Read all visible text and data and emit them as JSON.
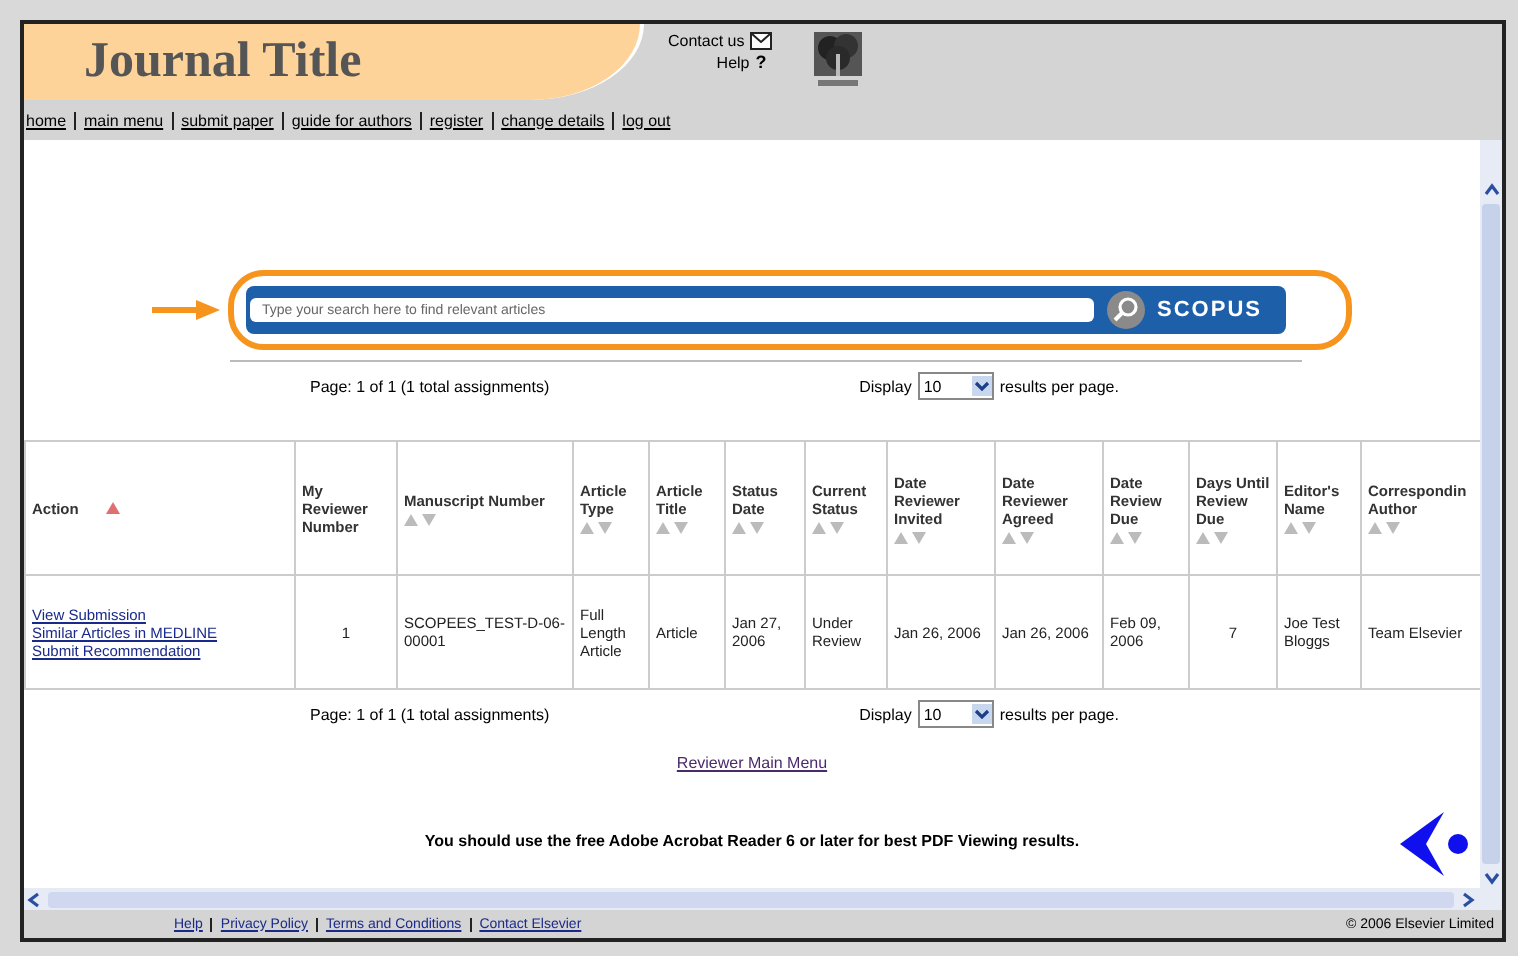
{
  "header": {
    "title": "Journal Title",
    "contact": "Contact us",
    "help": "Help",
    "help_mark": "?"
  },
  "nav": [
    {
      "label": "home"
    },
    {
      "label": "main menu"
    },
    {
      "label": "submit paper"
    },
    {
      "label": "guide for authors"
    },
    {
      "label": "register"
    },
    {
      "label": "change details"
    },
    {
      "label": "log out"
    }
  ],
  "search": {
    "placeholder": "Type your search here to find relevant articles",
    "brand": "SCOPUS"
  },
  "pagination_top": {
    "page": "Page: 1 of 1 (1 total assignments)",
    "display": "Display",
    "per_page": "10",
    "suffix": "results per page."
  },
  "table": {
    "columns": [
      {
        "label": "Action",
        "sorted": true
      },
      {
        "label": "My Reviewer Number"
      },
      {
        "label": "Manuscript Number",
        "sorted": false
      },
      {
        "label": "Article Type",
        "sorted": false
      },
      {
        "label": "Article Title",
        "sorted": false
      },
      {
        "label": "Status Date",
        "sorted": false
      },
      {
        "label": "Current Status",
        "sorted": false
      },
      {
        "label": "Date Reviewer Invited",
        "sorted": false
      },
      {
        "label": "Date Reviewer Agreed",
        "sorted": false
      },
      {
        "label": "Date Review Due",
        "sorted": false
      },
      {
        "label": "Days Until Review Due",
        "sorted": false
      },
      {
        "label": "Editor's Name",
        "sorted": false
      },
      {
        "label": "Correspondin Author",
        "sorted": false
      }
    ],
    "rows": [
      {
        "cells": [
          [
            "View Submission",
            "Similar Articles in MEDLINE",
            "Submit Recommendation"
          ],
          "1",
          "SCOPEES_TEST-D-06-00001",
          "Full Length Article",
          "Article",
          "Jan 27, 2006",
          "Under Review",
          "Jan 26, 2006",
          "Jan 26, 2006",
          "Feb 09, 2006",
          "7",
          "Joe Test Bloggs",
          "Team Elsevier"
        ]
      }
    ]
  },
  "pagination_bottom": {
    "page": "Page: 1 of 1 (1 total assignments)",
    "display": "Display",
    "per_page": "10",
    "suffix": "results per page."
  },
  "main_menu_link": "Reviewer Main Menu",
  "notice": "You should use the free Adobe Acrobat Reader 6 or later for best PDF Viewing results.",
  "footer": {
    "links": [
      {
        "label": "Help"
      },
      {
        "label": "Privacy Policy"
      },
      {
        "label": "Terms and Conditions"
      },
      {
        "label": "Contact Elsevier"
      }
    ],
    "copyright": "© 2006 Elsevier Limited"
  }
}
